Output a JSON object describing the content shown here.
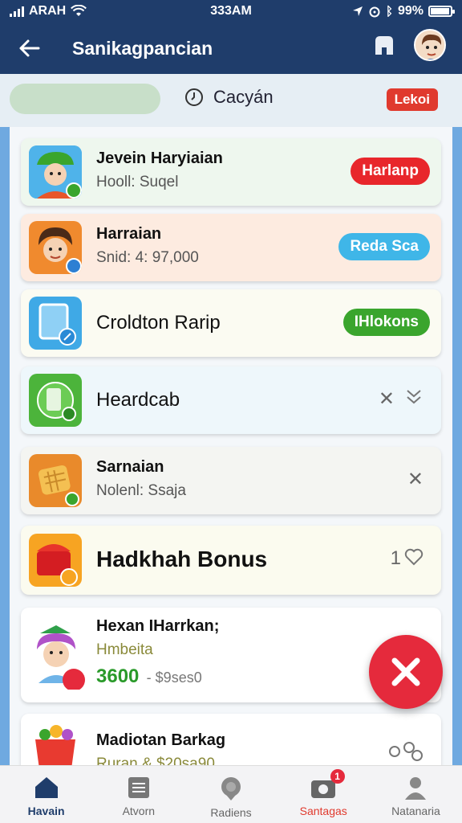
{
  "status_bar": {
    "carrier": "ARAH",
    "time": "333AM",
    "battery": "99%"
  },
  "header": {
    "title": "Sanikagpancian",
    "icons": [
      "back-arrow-icon",
      "store-icon",
      "profile-avatar"
    ]
  },
  "filter": {
    "label": "Cacyán",
    "badge": "Lekoi"
  },
  "cards": [
    {
      "title": "Jevein Haryiaian",
      "subtitle": "Hooll: Suqel",
      "action": "Harlanp",
      "action_color": "#e8262b"
    },
    {
      "title": "Harraian",
      "subtitle": "Snid: 4: 97,000",
      "action": "Reda Sca",
      "action_color": "#3fb6e8"
    },
    {
      "title": "Croldton Rarip",
      "action": "IHlokons",
      "action_color": "#3aa52d"
    },
    {
      "title": "Heardcab"
    },
    {
      "title": "Sarnaian",
      "subtitle": "Nolenl: Ssaja"
    },
    {
      "title": "Hadkhah Bonus",
      "count": "1"
    },
    {
      "title": "Hexan IHarrkan;",
      "subtitle": "Hmbeita",
      "price": "3600",
      "price_old": "- $9ses0"
    },
    {
      "title": "Madiotan Barkag",
      "subtitle": "Ruran & $20sa90"
    }
  ],
  "bottom_nav": [
    {
      "label": "Havain",
      "icon": "home-icon"
    },
    {
      "label": "Atvorn",
      "icon": "list-icon"
    },
    {
      "label": "Radiens",
      "icon": "pin-icon"
    },
    {
      "label": "Santagas",
      "icon": "shop-icon",
      "badge": "1"
    },
    {
      "label": "Natanaria",
      "icon": "person-icon"
    }
  ],
  "colors": {
    "primary": "#1f3d6b",
    "fab": "#e52a3c",
    "list_side": "#6fa9e0"
  }
}
